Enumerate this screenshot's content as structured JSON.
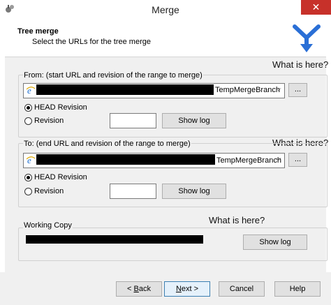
{
  "window": {
    "title": "Merge",
    "close_glyph": "✕"
  },
  "header": {
    "title": "Tree merge",
    "subtitle": "Select the URLs for the tree merge",
    "logo_icon": "merge-arrows-icon"
  },
  "annotations": {
    "from": "What is here?",
    "to": "What is here?",
    "working_copy": "What is here?"
  },
  "from_group": {
    "label": "From: (start URL and revision of the range to merge)",
    "url_suffix": "TempMergeBranch",
    "browse_label": "...",
    "head_revision_label": "HEAD Revision",
    "revision_label": "Revision",
    "revision_value": "",
    "show_log_label": "Show log",
    "selected": "head"
  },
  "to_group": {
    "label": "To: (end URL and revision of the range to merge)",
    "url_suffix": "TempMergeBranch",
    "browse_label": "...",
    "head_revision_label": "HEAD Revision",
    "revision_label": "Revision",
    "revision_value": "",
    "show_log_label": "Show log",
    "selected": "head"
  },
  "working_copy": {
    "label": "Working Copy",
    "show_log_label": "Show log"
  },
  "footer": {
    "back_prefix": "< ",
    "back_mnemonic": "B",
    "back_rest": "ack",
    "next_prefix": "",
    "next_mnemonic": "N",
    "next_rest": "ext >",
    "cancel_label": "Cancel",
    "help_label": "Help"
  },
  "colors": {
    "close_button": "#c7312a",
    "focus_border": "#3c7fb1",
    "logo": "#2a6fd6"
  }
}
